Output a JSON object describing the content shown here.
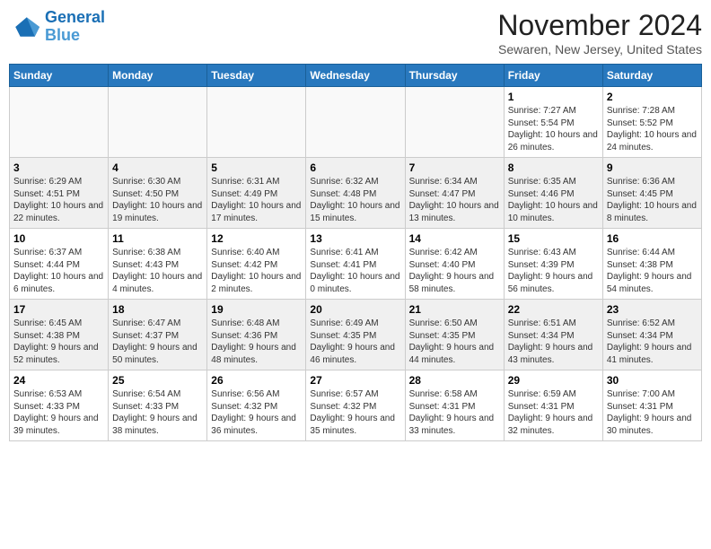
{
  "header": {
    "logo_line1": "General",
    "logo_line2": "Blue",
    "title": "November 2024",
    "subtitle": "Sewaren, New Jersey, United States"
  },
  "days_of_week": [
    "Sunday",
    "Monday",
    "Tuesday",
    "Wednesday",
    "Thursday",
    "Friday",
    "Saturday"
  ],
  "weeks": [
    [
      {
        "day": "",
        "info": ""
      },
      {
        "day": "",
        "info": ""
      },
      {
        "day": "",
        "info": ""
      },
      {
        "day": "",
        "info": ""
      },
      {
        "day": "",
        "info": ""
      },
      {
        "day": "1",
        "info": "Sunrise: 7:27 AM\nSunset: 5:54 PM\nDaylight: 10 hours and 26 minutes."
      },
      {
        "day": "2",
        "info": "Sunrise: 7:28 AM\nSunset: 5:52 PM\nDaylight: 10 hours and 24 minutes."
      }
    ],
    [
      {
        "day": "3",
        "info": "Sunrise: 6:29 AM\nSunset: 4:51 PM\nDaylight: 10 hours and 22 minutes."
      },
      {
        "day": "4",
        "info": "Sunrise: 6:30 AM\nSunset: 4:50 PM\nDaylight: 10 hours and 19 minutes."
      },
      {
        "day": "5",
        "info": "Sunrise: 6:31 AM\nSunset: 4:49 PM\nDaylight: 10 hours and 17 minutes."
      },
      {
        "day": "6",
        "info": "Sunrise: 6:32 AM\nSunset: 4:48 PM\nDaylight: 10 hours and 15 minutes."
      },
      {
        "day": "7",
        "info": "Sunrise: 6:34 AM\nSunset: 4:47 PM\nDaylight: 10 hours and 13 minutes."
      },
      {
        "day": "8",
        "info": "Sunrise: 6:35 AM\nSunset: 4:46 PM\nDaylight: 10 hours and 10 minutes."
      },
      {
        "day": "9",
        "info": "Sunrise: 6:36 AM\nSunset: 4:45 PM\nDaylight: 10 hours and 8 minutes."
      }
    ],
    [
      {
        "day": "10",
        "info": "Sunrise: 6:37 AM\nSunset: 4:44 PM\nDaylight: 10 hours and 6 minutes."
      },
      {
        "day": "11",
        "info": "Sunrise: 6:38 AM\nSunset: 4:43 PM\nDaylight: 10 hours and 4 minutes."
      },
      {
        "day": "12",
        "info": "Sunrise: 6:40 AM\nSunset: 4:42 PM\nDaylight: 10 hours and 2 minutes."
      },
      {
        "day": "13",
        "info": "Sunrise: 6:41 AM\nSunset: 4:41 PM\nDaylight: 10 hours and 0 minutes."
      },
      {
        "day": "14",
        "info": "Sunrise: 6:42 AM\nSunset: 4:40 PM\nDaylight: 9 hours and 58 minutes."
      },
      {
        "day": "15",
        "info": "Sunrise: 6:43 AM\nSunset: 4:39 PM\nDaylight: 9 hours and 56 minutes."
      },
      {
        "day": "16",
        "info": "Sunrise: 6:44 AM\nSunset: 4:38 PM\nDaylight: 9 hours and 54 minutes."
      }
    ],
    [
      {
        "day": "17",
        "info": "Sunrise: 6:45 AM\nSunset: 4:38 PM\nDaylight: 9 hours and 52 minutes."
      },
      {
        "day": "18",
        "info": "Sunrise: 6:47 AM\nSunset: 4:37 PM\nDaylight: 9 hours and 50 minutes."
      },
      {
        "day": "19",
        "info": "Sunrise: 6:48 AM\nSunset: 4:36 PM\nDaylight: 9 hours and 48 minutes."
      },
      {
        "day": "20",
        "info": "Sunrise: 6:49 AM\nSunset: 4:35 PM\nDaylight: 9 hours and 46 minutes."
      },
      {
        "day": "21",
        "info": "Sunrise: 6:50 AM\nSunset: 4:35 PM\nDaylight: 9 hours and 44 minutes."
      },
      {
        "day": "22",
        "info": "Sunrise: 6:51 AM\nSunset: 4:34 PM\nDaylight: 9 hours and 43 minutes."
      },
      {
        "day": "23",
        "info": "Sunrise: 6:52 AM\nSunset: 4:34 PM\nDaylight: 9 hours and 41 minutes."
      }
    ],
    [
      {
        "day": "24",
        "info": "Sunrise: 6:53 AM\nSunset: 4:33 PM\nDaylight: 9 hours and 39 minutes."
      },
      {
        "day": "25",
        "info": "Sunrise: 6:54 AM\nSunset: 4:33 PM\nDaylight: 9 hours and 38 minutes."
      },
      {
        "day": "26",
        "info": "Sunrise: 6:56 AM\nSunset: 4:32 PM\nDaylight: 9 hours and 36 minutes."
      },
      {
        "day": "27",
        "info": "Sunrise: 6:57 AM\nSunset: 4:32 PM\nDaylight: 9 hours and 35 minutes."
      },
      {
        "day": "28",
        "info": "Sunrise: 6:58 AM\nSunset: 4:31 PM\nDaylight: 9 hours and 33 minutes."
      },
      {
        "day": "29",
        "info": "Sunrise: 6:59 AM\nSunset: 4:31 PM\nDaylight: 9 hours and 32 minutes."
      },
      {
        "day": "30",
        "info": "Sunrise: 7:00 AM\nSunset: 4:31 PM\nDaylight: 9 hours and 30 minutes."
      }
    ]
  ]
}
